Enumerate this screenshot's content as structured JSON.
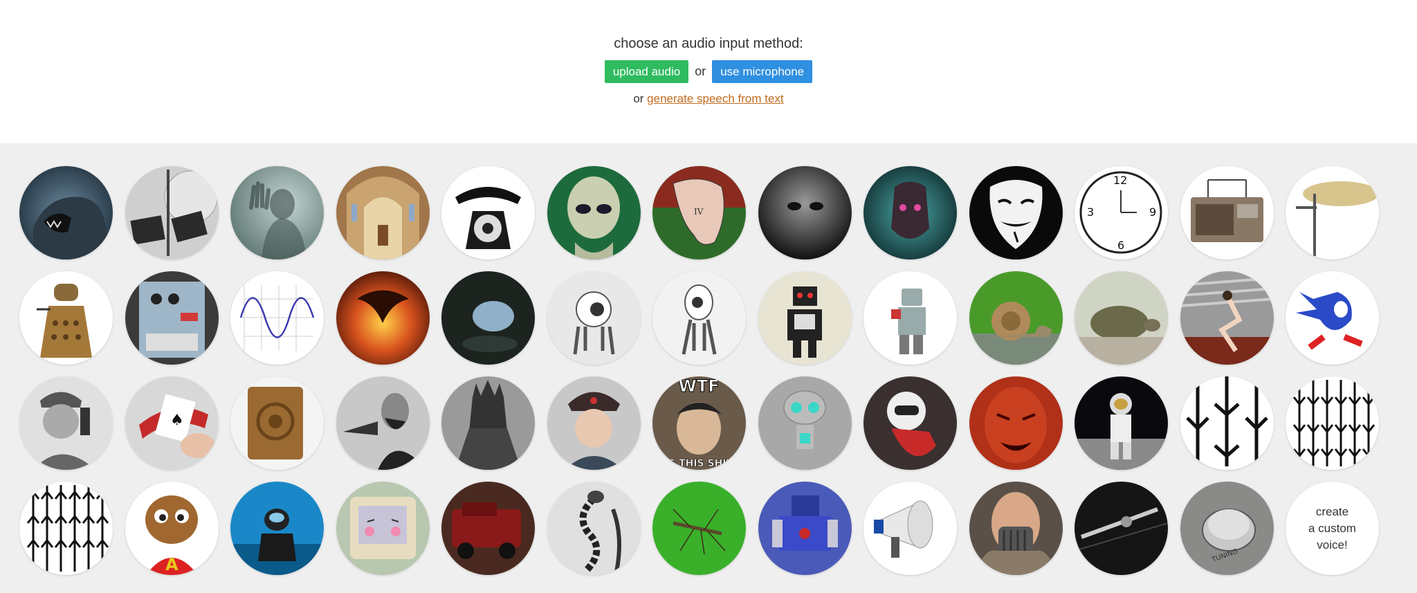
{
  "header": {
    "prompt": "choose an audio input method:",
    "upload_label": "upload audio",
    "or_label": "or",
    "microphone_label": "use microphone",
    "or_prefix": "or",
    "generate_link": "generate speech from text"
  },
  "colors": {
    "upload_button": "#2fbb5f",
    "microphone_button": "#2f8fe0",
    "link": "#c26b1f",
    "grid_background": "#efefef"
  },
  "voices": [
    {
      "name": "godzilla-icon"
    },
    {
      "name": "gramophone-icon"
    },
    {
      "name": "ghost-icon"
    },
    {
      "name": "cathedral-icon"
    },
    {
      "name": "rotary-telephone-icon"
    },
    {
      "name": "alien-icon"
    },
    {
      "name": "melting-clock-icon"
    },
    {
      "name": "grey-alien-icon"
    },
    {
      "name": "cyborg-icon"
    },
    {
      "name": "anonymous-mask-icon"
    },
    {
      "name": "reversed-clock-icon"
    },
    {
      "name": "radio-icon"
    },
    {
      "name": "cymbal-icon"
    },
    {
      "name": "dalek-icon"
    },
    {
      "name": "effects-pedal-icon"
    },
    {
      "name": "sine-wave-icon"
    },
    {
      "name": "balrog-icon"
    },
    {
      "name": "cave-icon"
    },
    {
      "name": "white-robot-icon"
    },
    {
      "name": "white-robot-2-icon"
    },
    {
      "name": "toy-robot-icon"
    },
    {
      "name": "lego-robot-icon"
    },
    {
      "name": "snail-icon"
    },
    {
      "name": "tortoise-icon"
    },
    {
      "name": "sprinter-icon"
    },
    {
      "name": "sonic-icon"
    },
    {
      "name": "soldier-radio-icon"
    },
    {
      "name": "playing-cards-icon"
    },
    {
      "name": "wooden-speaker-icon"
    },
    {
      "name": "phonograph-man-icon"
    },
    {
      "name": "sauron-icon"
    },
    {
      "name": "russian-soldier-icon"
    },
    {
      "name": "wtf-meme-icon",
      "caption_top": "WTF",
      "caption_bottom": "IS THIS SHIT"
    },
    {
      "name": "gir-robot-icon"
    },
    {
      "name": "kirobo-robot-icon"
    },
    {
      "name": "demon-icon"
    },
    {
      "name": "astronaut-icon"
    },
    {
      "name": "arrows-down-icon"
    },
    {
      "name": "arrows-down-many-icon"
    },
    {
      "name": "arrows-up-icon"
    },
    {
      "name": "chipmunk-icon"
    },
    {
      "name": "scuba-diver-icon"
    },
    {
      "name": "retro-computer-icon"
    },
    {
      "name": "red-truck-icon"
    },
    {
      "name": "cable-snake-icon"
    },
    {
      "name": "mosquito-icon"
    },
    {
      "name": "transformer-robot-icon"
    },
    {
      "name": "megaphone-icon"
    },
    {
      "name": "bane-icon"
    },
    {
      "name": "turntable-icon"
    },
    {
      "name": "knob-icon",
      "caption_top": "TUNING"
    }
  ],
  "custom_voice": {
    "line1": "create",
    "line2": "a custom",
    "line3": "voice!"
  }
}
